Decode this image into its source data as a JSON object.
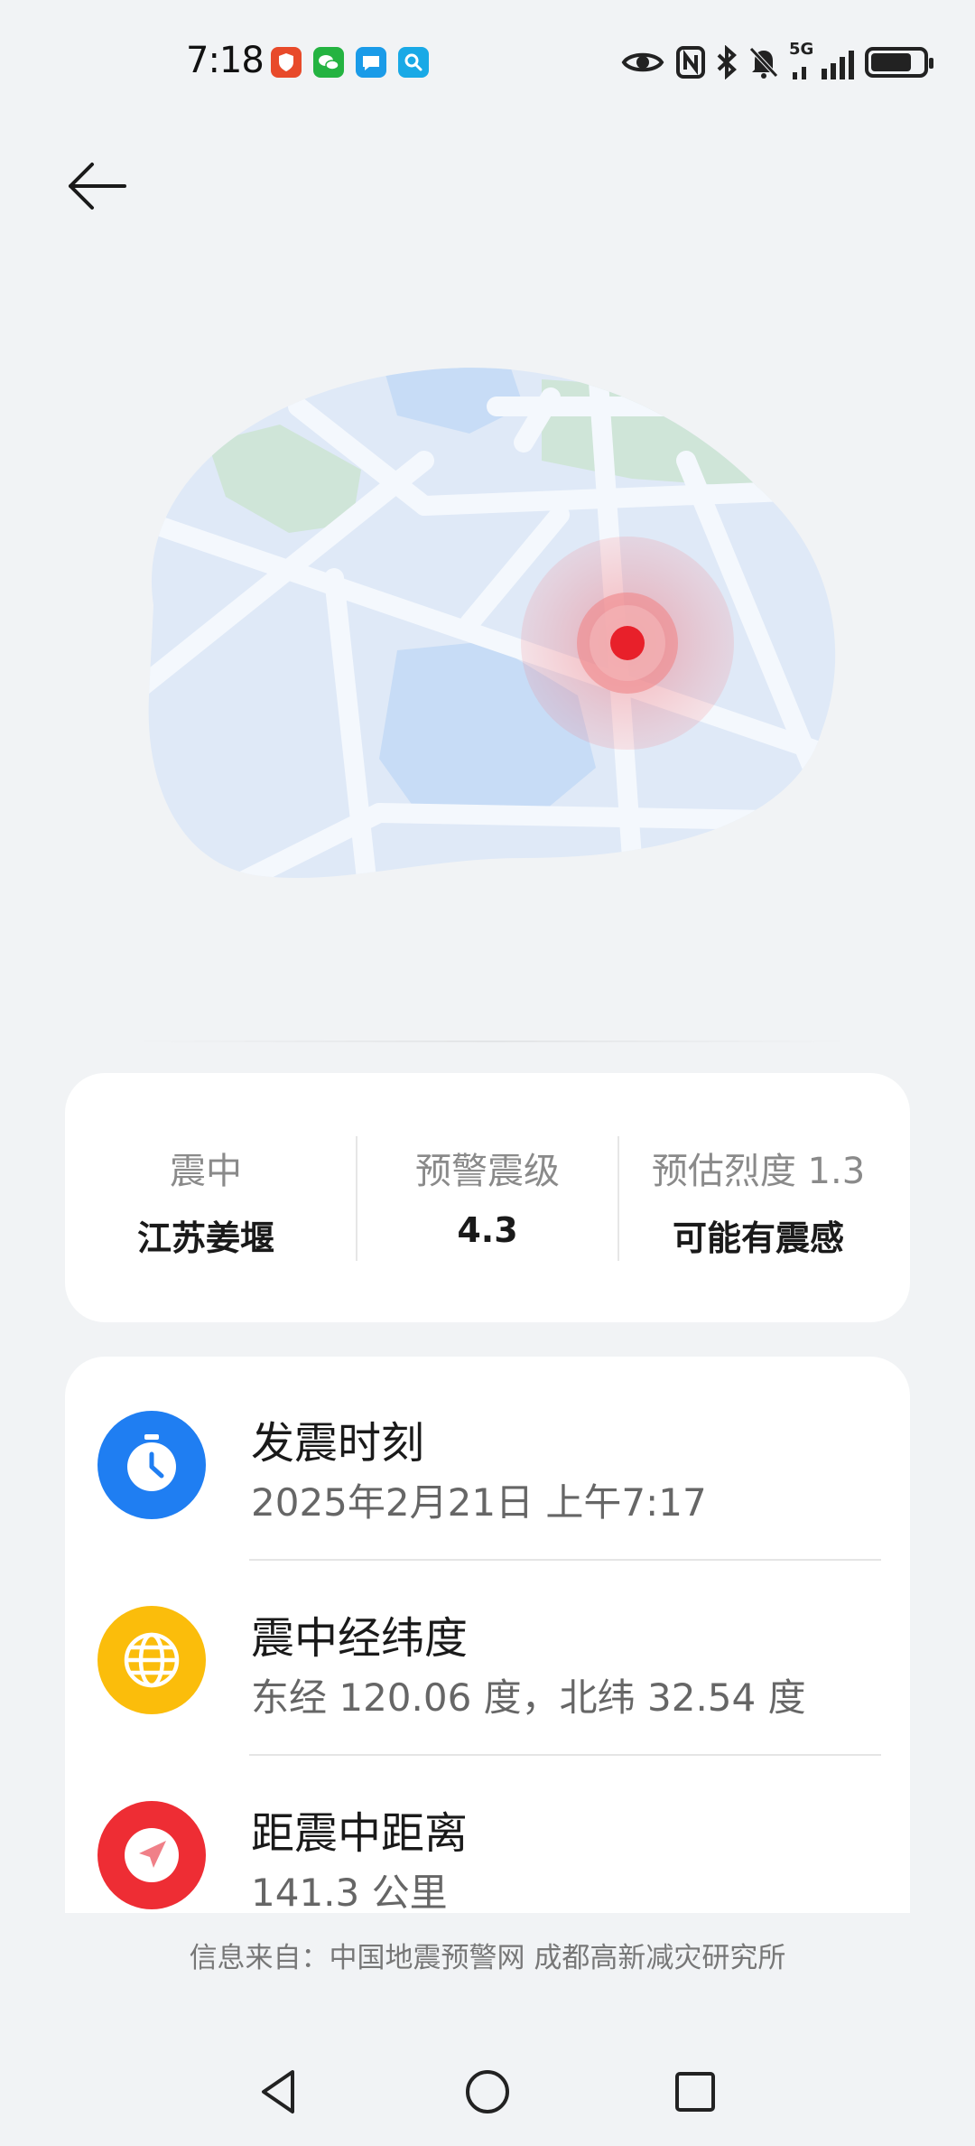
{
  "status_bar": {
    "time": "7:18",
    "network": "5G",
    "notification_icons": [
      "shield-app-icon",
      "wechat-icon",
      "message-icon",
      "search-app-icon"
    ],
    "system_icons": [
      "eye-icon",
      "nfc-icon",
      "bluetooth-icon",
      "mute-bell-icon",
      "signal-icon",
      "battery-icon"
    ],
    "battery_level": 0.8
  },
  "header": {
    "back_icon": "back-arrow-icon"
  },
  "map": {
    "marker_icon": "epicenter-marker-icon",
    "marker_color": "#e8202a"
  },
  "summary": {
    "columns": [
      {
        "label": "震中",
        "value": "江苏姜堰"
      },
      {
        "label": "预警震级",
        "value": "4.3"
      },
      {
        "label": "预估烈度 1.3",
        "value": "可能有震感"
      }
    ]
  },
  "details": [
    {
      "icon": "clock-icon",
      "color": "#1f7ef2",
      "title": "发震时刻",
      "value": "2025年2月21日 上午7:17"
    },
    {
      "icon": "globe-icon",
      "color": "#fbbd0b",
      "title": "震中经纬度",
      "value": "东经 120.06 度，北纬 32.54 度"
    },
    {
      "icon": "navigation-icon",
      "color": "#ee2d34",
      "title": "距震中距离",
      "value": "141.3 公里"
    }
  ],
  "source": "信息来自：中国地震预警网 成都高新减灾研究所",
  "nav": {
    "back_icon": "nav-back-icon",
    "home_icon": "nav-home-icon",
    "recents_icon": "nav-recents-icon"
  }
}
